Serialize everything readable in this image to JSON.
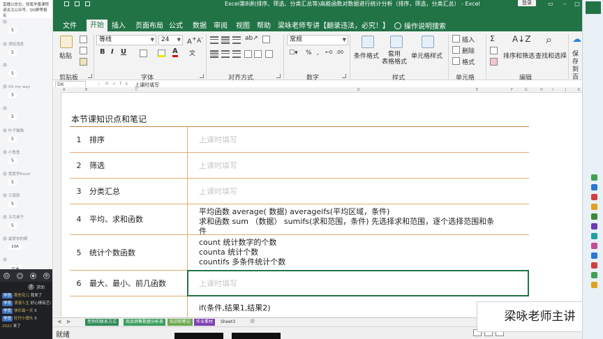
{
  "chat": {
    "notice": "直播公告位，知笔学唐课程请关注公众号、QQ群等报名",
    "messages": [
      {
        "user": "",
        "text": "5"
      },
      {
        "user": "添加消息",
        "text": "5"
      },
      {
        "user": "",
        "text": "5"
      },
      {
        "user": "Oh my way",
        "text": "5"
      },
      {
        "user": "",
        "text": "5"
      },
      {
        "user": "叶子猫猫",
        "text": "5"
      },
      {
        "user": "小鱼鱼",
        "text": "5"
      },
      {
        "user": "我爱学Excel",
        "text": "5"
      },
      {
        "user": "江南雨",
        "text": "5"
      },
      {
        "user": "五月桌子",
        "text": "5"
      },
      {
        "user": "最爱你的眼",
        "text": "33A"
      },
      {
        "user": "",
        "text": "文本"
      }
    ],
    "ask_label": "求助",
    "live": [
      {
        "tag": "学员",
        "user": "那些花儿",
        "text": "我来了"
      },
      {
        "tag": "学员",
        "user": "浪漫人生",
        "text": "好心情有艺术"
      },
      {
        "tag": "学员",
        "user": "快乐每一天",
        "text": "5"
      },
      {
        "tag": "学员",
        "user": "旺仔小馒头",
        "text": "5"
      },
      {
        "tag": "",
        "user": "2022",
        "text": "来了"
      }
    ]
  },
  "titlebar": {
    "title": "Excel第8讲(排序、筛选、分类汇总等)高能函数对数据进行统计分析（排序，筛选，分类汇总） - Excel",
    "login": "登录"
  },
  "tabs": [
    {
      "label": "文件",
      "active": false
    },
    {
      "label": "开始",
      "active": true
    },
    {
      "label": "插入",
      "active": false
    },
    {
      "label": "页面布局",
      "active": false
    },
    {
      "label": "公式",
      "active": false
    },
    {
      "label": "数据",
      "active": false
    },
    {
      "label": "审阅",
      "active": false
    },
    {
      "label": "视图",
      "active": false
    },
    {
      "label": "帮助",
      "active": false
    },
    {
      "label": "梁咏老师专讲【翻录违法，必究！】",
      "active": false
    },
    {
      "label": "操作说明搜索",
      "active": false
    }
  ],
  "ribbon": {
    "paste": "粘贴",
    "font_name": "等线",
    "font_size": "24",
    "number_format": "常规",
    "conditional": "条件格式",
    "table_fmt": "套用\n表格格式",
    "cell_style": "单元格样式",
    "insert": "插入",
    "delete": "删除",
    "format": "格式",
    "sort_filter": "排序和筛选",
    "find_select": "查找和选择",
    "save": "保存到\n百度网盘",
    "groups": {
      "clipboard": "剪贴板",
      "font": "字体",
      "align": "对齐方式",
      "number": "数字",
      "styles": "样式",
      "cells": "单元格",
      "editing": "编辑"
    }
  },
  "formulabar": {
    "cell_ref": "D8",
    "content": "上课时填写"
  },
  "columns": [
    "A",
    "B",
    "C",
    "D",
    "E",
    "F",
    "G",
    "H",
    "I",
    "J",
    "K"
  ],
  "notes": {
    "title": "本节课知识点和笔记",
    "rows": [
      {
        "num": "1",
        "topic": "排序",
        "note": "上课时填写"
      },
      {
        "num": "2",
        "topic": "筛选",
        "note": "上课时填写"
      },
      {
        "num": "3",
        "topic": "分类汇总",
        "note": "上课时填写"
      },
      {
        "num": "4",
        "topic": "平均、求和函数",
        "lines": [
          "平均函数 average( 数据)   averageifs(平均区域，条件)",
          "求和函数 sum （数据）   sumifs(求和范围，条件) 先选择求和范围，逐个选择范围和条",
          "件"
        ]
      },
      {
        "num": "5",
        "topic": "统计个数函数",
        "lines": [
          "count  统计数字的个数",
          "counta 统计个数",
          "countifs 多条件统计个数"
        ]
      },
      {
        "num": "6",
        "topic": "最大、最小、前几函数",
        "note": "上课时填写"
      },
      {
        "num": "",
        "topic": "",
        "lines": [
          "if(条件,结果1,结果2)"
        ]
      }
    ]
  },
  "sheets": [
    {
      "label": "老师的联系方式",
      "color": "#2e8b57"
    },
    {
      "label": "商品销售数据分析表",
      "color": "#3a9d5d"
    },
    {
      "label": "知识和笔记",
      "color": "#6aa84f"
    },
    {
      "label": "作业素材",
      "color": "#7d3fb2"
    },
    {
      "label": "Sheet3",
      "color": ""
    }
  ],
  "status": {
    "ready": "就绪"
  },
  "watermark": "梁咏老师主讲"
}
